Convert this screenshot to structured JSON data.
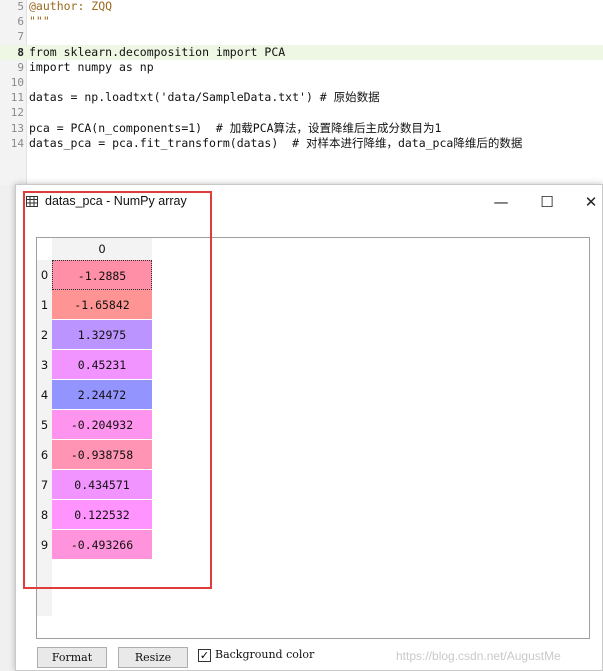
{
  "editor": {
    "lines": [
      {
        "num": "5",
        "text": "@author: ZQQ",
        "kind": "comment"
      },
      {
        "num": "6",
        "text": "\"\"\"",
        "kind": "comment"
      },
      {
        "num": "7",
        "text": "",
        "kind": "code"
      },
      {
        "num": "8",
        "text": "from sklearn.decomposition import PCA",
        "kind": "code",
        "active": true
      },
      {
        "num": "9",
        "text": "import numpy as np",
        "kind": "code"
      },
      {
        "num": "10",
        "text": "",
        "kind": "code"
      },
      {
        "num": "11",
        "text": "datas = np.loadtxt('data/SampleData.txt') # 原始数据",
        "kind": "code"
      },
      {
        "num": "12",
        "text": "",
        "kind": "code"
      },
      {
        "num": "13",
        "text": "pca = PCA(n_components=1)  # 加载PCA算法，设置降维后主成分数目为1",
        "kind": "code"
      },
      {
        "num": "14",
        "text": "datas_pca = pca.fit_transform(datas)  # 对样本进行降维，data_pca降维后的数据",
        "kind": "code"
      }
    ]
  },
  "window": {
    "title": "datas_pca - NumPy array",
    "minimize": "—",
    "maximize": "☐",
    "close": "✕",
    "column_header": "0",
    "rows": [
      {
        "index": "0",
        "value": "-1.2885",
        "color": "#ff8fa6"
      },
      {
        "index": "1",
        "value": "-1.65842",
        "color": "#ff9494"
      },
      {
        "index": "2",
        "value": "1.32975",
        "color": "#bc94ff"
      },
      {
        "index": "3",
        "value": "0.45231",
        "color": "#f294ff"
      },
      {
        "index": "4",
        "value": "2.24472",
        "color": "#9494ff"
      },
      {
        "index": "5",
        "value": "-0.204932",
        "color": "#ff94ef"
      },
      {
        "index": "6",
        "value": "-0.938758",
        "color": "#ff94b4"
      },
      {
        "index": "7",
        "value": "0.434571",
        "color": "#f294ff"
      },
      {
        "index": "8",
        "value": "0.122532",
        "color": "#ff94ff"
      },
      {
        "index": "9",
        "value": "-0.493266",
        "color": "#ff94dc"
      }
    ],
    "format_label": "Format",
    "resize_label": "Resize",
    "background_color_label": "Background color",
    "background_color_checked": true,
    "watermark": "https://blog.csdn.net/AugustMe"
  }
}
